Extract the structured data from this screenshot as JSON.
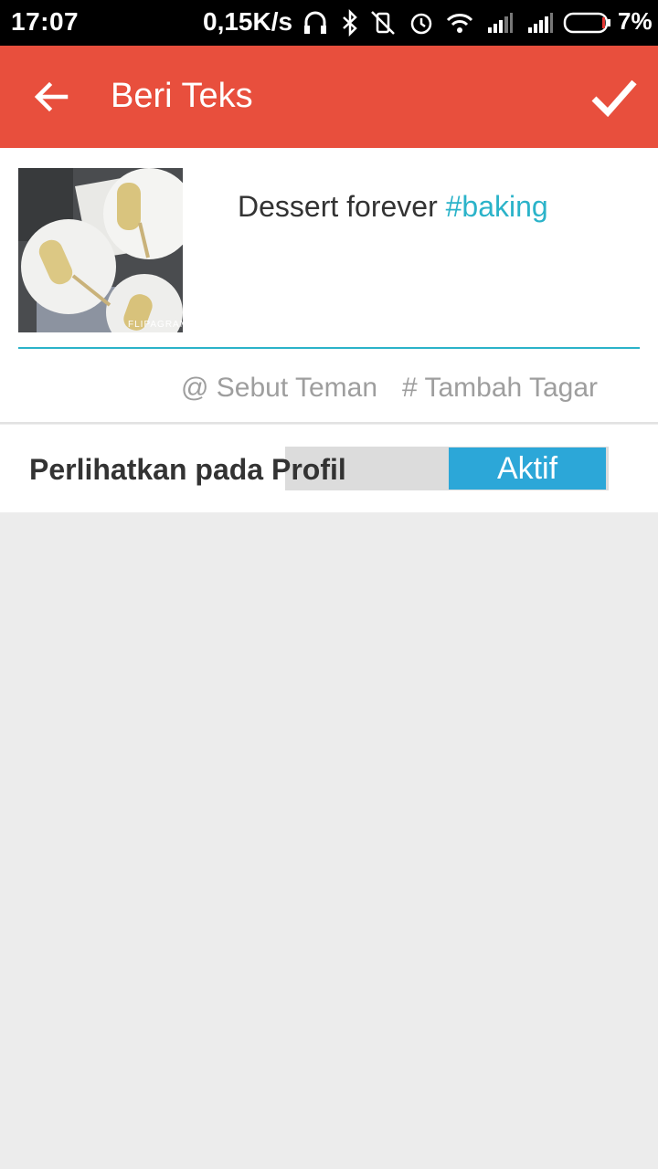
{
  "status_bar": {
    "time": "17:07",
    "net_speed": "0,15K/s",
    "battery_percent": "7%",
    "icons": [
      "headset-icon",
      "bluetooth-icon",
      "vibrate-off-icon",
      "alarm-icon",
      "wifi-icon",
      "signal-icon",
      "signal-icon",
      "battery-icon"
    ]
  },
  "app_bar": {
    "title": "Beri Teks",
    "back_icon": "arrow-left-icon",
    "confirm_icon": "check-icon",
    "color": "#e84f3d"
  },
  "post": {
    "thumbnail_watermark": "FLIPAGRAM",
    "caption_text": "Dessert forever ",
    "caption_hashtag": "#baking",
    "accent_color": "#2bb3c9"
  },
  "actions": {
    "mention": "@ Sebut Teman",
    "hashtag": "# Tambah Tagar"
  },
  "profile_setting": {
    "label": "Perlihatkan pada Profil",
    "state": "Aktif",
    "toggle_color": "#2ca7d8"
  }
}
